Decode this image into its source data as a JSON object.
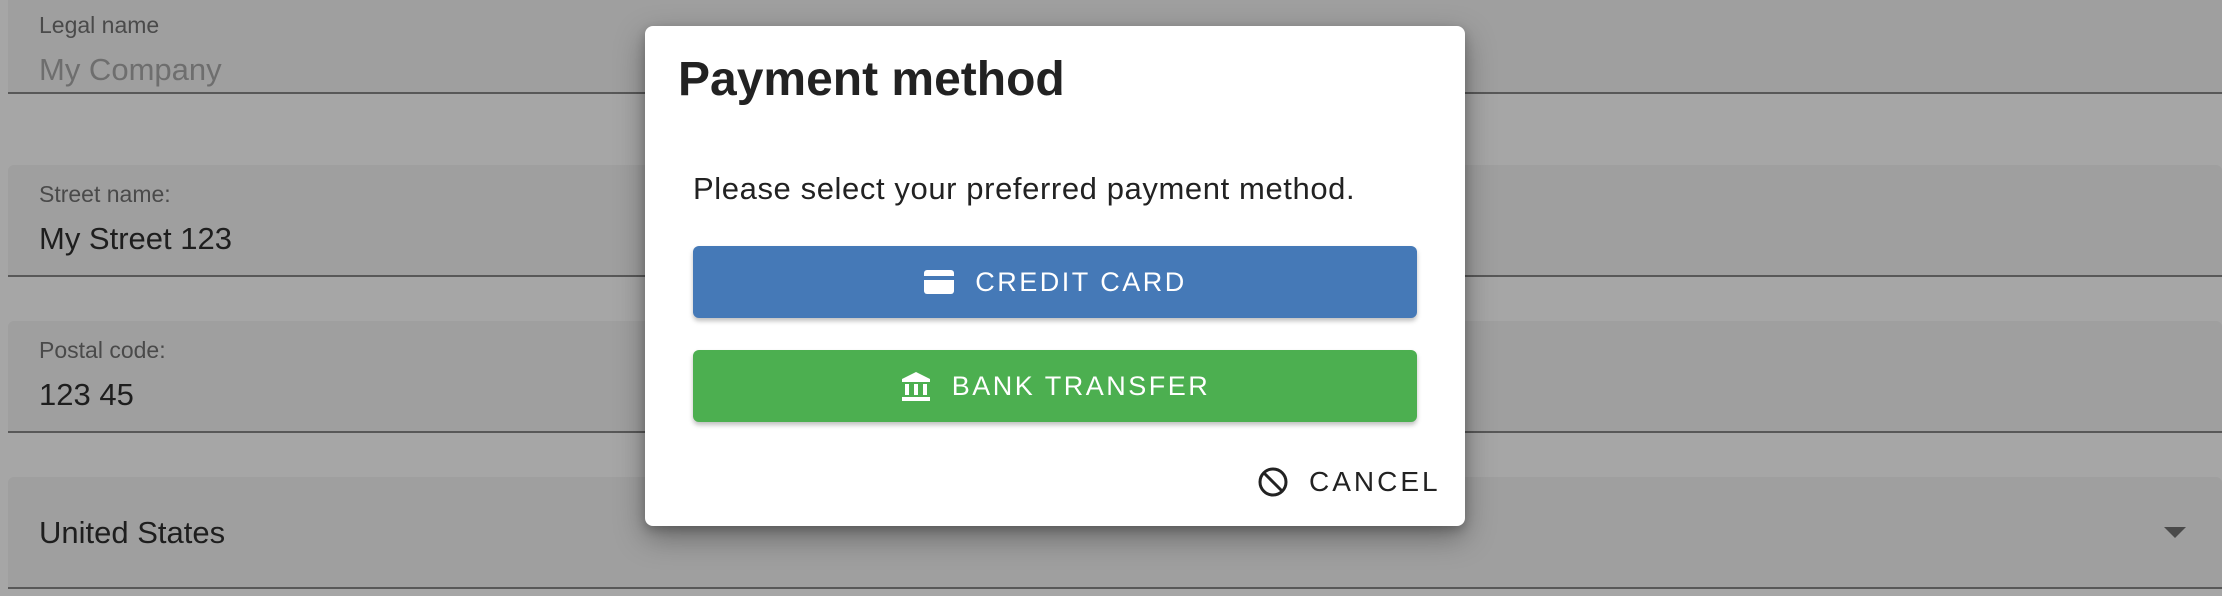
{
  "form": {
    "legal_name": {
      "label": "Legal name",
      "placeholder": "My Company"
    },
    "street_name": {
      "label": "Street name:",
      "value": "My Street 123"
    },
    "postal_code": {
      "label": "Postal code:",
      "value": "123 45"
    },
    "country": {
      "value": "United States"
    }
  },
  "dialog": {
    "title": "Payment method",
    "message": "Please select your preferred payment method.",
    "credit_card_label": "CREDIT CARD",
    "bank_transfer_label": "BANK TRANSFER",
    "cancel_label": "CANCEL"
  },
  "icons": {
    "credit_card": "credit-card-icon",
    "bank": "bank-icon",
    "cancel": "cancel-icon",
    "dropdown": "chevron-down-icon"
  },
  "colors": {
    "credit_card_button": "#4579b7",
    "bank_transfer_button": "#4caf50",
    "backdrop": "#a6a6a6"
  }
}
